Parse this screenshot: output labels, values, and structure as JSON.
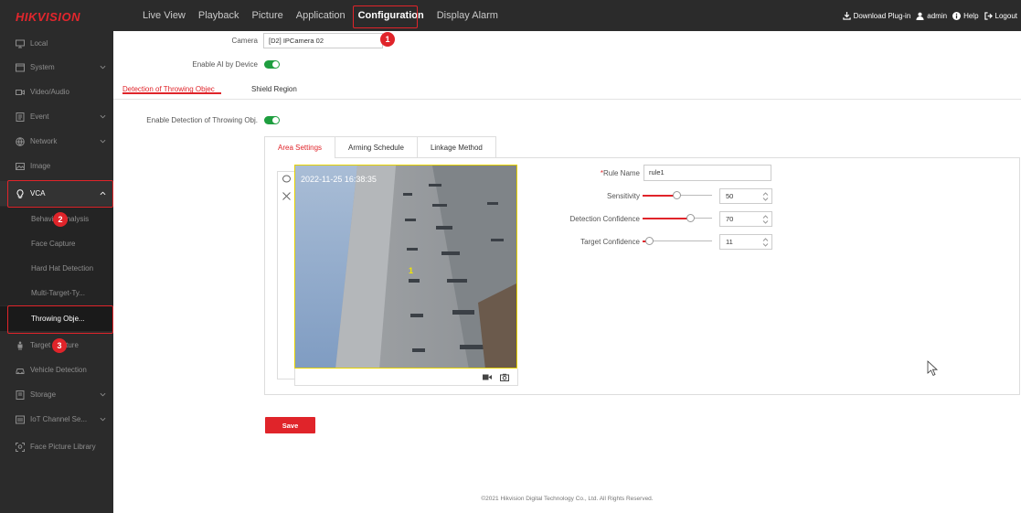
{
  "app": {
    "logo": "HIKVISION"
  },
  "nav": {
    "items": [
      "Live View",
      "Playback",
      "Picture",
      "Application",
      "Configuration",
      "Display Alarm"
    ],
    "active": "Configuration"
  },
  "header_right": {
    "download": "Download Plug-in",
    "user": "admin",
    "help": "Help",
    "logout": "Logout"
  },
  "sidebar": {
    "items": {
      "local": "Local",
      "system": "System",
      "video_audio": "Video/Audio",
      "event": "Event",
      "network": "Network",
      "image": "Image",
      "vca": "VCA",
      "target_capture": "Target Capture",
      "vehicle_detection": "Vehicle Detection",
      "storage": "Storage",
      "iot_channel": "IoT Channel Se...",
      "face_library": "Face Picture Library"
    },
    "vca_sub": {
      "behavior": "Behavior Analysis",
      "face_capture": "Face Capture",
      "hard_hat": "Hard Hat Detection",
      "multi_target": "Multi-Target-Ty...",
      "throwing": "Throwing Obje..."
    }
  },
  "markers": [
    "1",
    "2",
    "3"
  ],
  "form": {
    "camera_label": "Camera",
    "camera_value": "[D2] IPCamera 02",
    "enable_ai_label": "Enable AI by Device",
    "enable_ai": true
  },
  "tabs": {
    "detection": "Detection of Throwing Objec",
    "shield": "Shield Region"
  },
  "detection": {
    "enable_label": "Enable Detection of Throwing Obj.",
    "enabled": true
  },
  "sub_tabs": [
    "Area Settings",
    "Arming Schedule",
    "Linkage Method"
  ],
  "video": {
    "osd_timestamp": "2022-11-25 16:38:35",
    "region_id": "1"
  },
  "rule": {
    "name_label": "Rule Name",
    "name_value": "rule1",
    "sensitivity_label": "Sensitivity",
    "sensitivity": 50,
    "detection_confidence_label": "Detection Confidence",
    "detection_confidence": 70,
    "target_confidence_label": "Target Confidence",
    "target_confidence": 11
  },
  "save_label": "Save",
  "footer": "©2021 Hikvision Digital Technology Co., Ltd. All Rights Reserved.",
  "colors": {
    "accent": "#e0242a",
    "toggle_on": "#1e9e3f",
    "sidebar_bg": "#2b2b2b"
  }
}
